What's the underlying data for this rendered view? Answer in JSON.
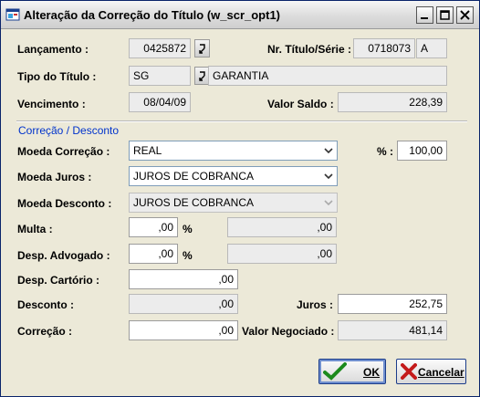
{
  "window": {
    "title": "Alteração da Correção do Título (w_scr_opt1)"
  },
  "fields": {
    "lancamento": {
      "label": "Lançamento :",
      "value": "0425872"
    },
    "nr_titulo": {
      "label": "Nr. Título/Série :",
      "value": "0718073",
      "serie": "A"
    },
    "tipo_titulo": {
      "label": "Tipo do Título :",
      "code": "SG",
      "description": "GARANTIA"
    },
    "vencimento": {
      "label": "Vencimento :",
      "value": "08/04/09"
    },
    "valor_saldo": {
      "label": "Valor Saldo :",
      "value": "228,39"
    }
  },
  "section": {
    "title": "Correção / Desconto"
  },
  "correcao": {
    "moeda_correcao": {
      "label": "Moeda Correção :",
      "value": "REAL"
    },
    "percent": {
      "label": "% :",
      "value": "100,00"
    },
    "moeda_juros": {
      "label": "Moeda Juros :",
      "value": "JUROS DE COBRANCA"
    },
    "moeda_desconto": {
      "label": "Moeda Desconto :",
      "value": "JUROS DE COBRANCA"
    },
    "multa": {
      "label": "Multa :",
      "value": ",00",
      "pct": "%",
      "calc": ",00"
    },
    "desp_advogado": {
      "label": "Desp. Advogado :",
      "value": ",00",
      "pct": "%",
      "calc": ",00"
    },
    "desp_cartorio": {
      "label": "Desp. Cartório :",
      "value": ",00"
    },
    "desconto": {
      "label": "Desconto :",
      "value": ",00"
    },
    "juros": {
      "label": "Juros :",
      "value": "252,75"
    },
    "correcao": {
      "label": "Correção  :",
      "value": ",00"
    },
    "valor_negociado": {
      "label": "Valor Negociado :",
      "value": "481,14"
    }
  },
  "buttons": {
    "ok": "OK",
    "cancel": "Cancelar"
  }
}
